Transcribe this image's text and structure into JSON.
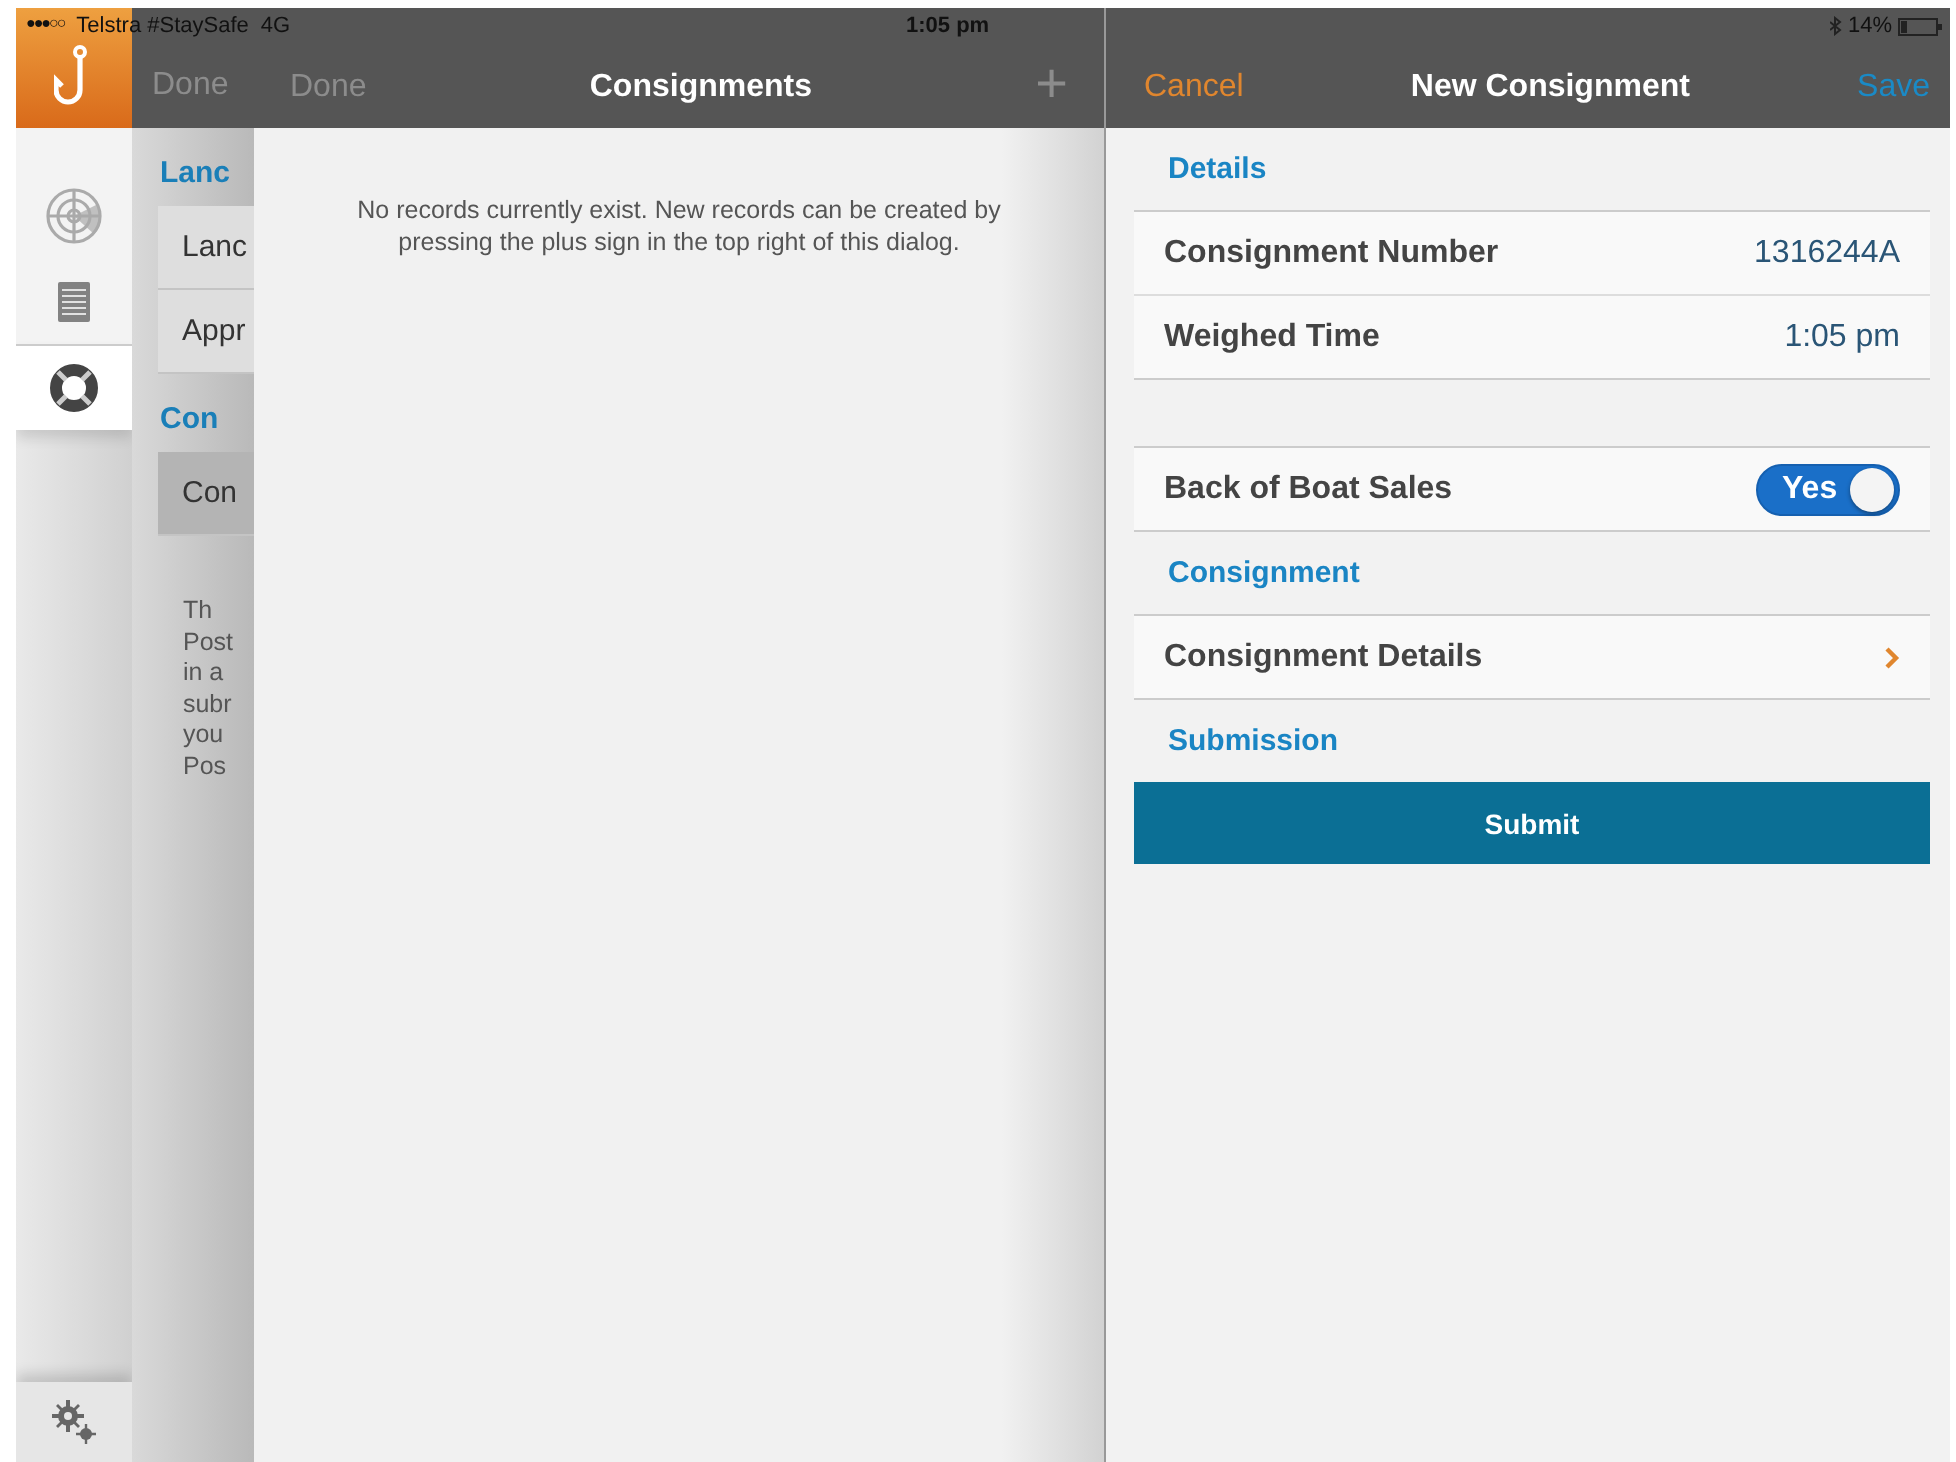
{
  "status_bar": {
    "signal": "●●●○○",
    "carrier": "Telstra #StaySafe",
    "network": "4G",
    "time": "1:05 pm",
    "battery": "14%"
  },
  "sidebar": {
    "items": [
      {
        "selected": false
      },
      {
        "selected": false
      },
      {
        "selected": true
      }
    ]
  },
  "back_panel": {
    "left_button": {
      "label": "Done",
      "disabled": true
    },
    "sections": [
      {
        "header": "Lanc",
        "rows": [
          {
            "label": "Lanc",
            "selected": false
          },
          {
            "label": "Appr",
            "selected": false
          }
        ]
      },
      {
        "header": "Con",
        "rows": [
          {
            "label": "Con",
            "selected": true
          }
        ]
      }
    ],
    "note_lines": [
      "Th",
      "Post",
      "in a",
      "subr",
      "you",
      "Pos"
    ]
  },
  "consignments_panel": {
    "title": "Consignments",
    "left_button": {
      "label": "Done",
      "disabled": true
    },
    "add_button": {
      "label": "+",
      "disabled": true
    },
    "message": "No records currently exist. New records can be created by pressing the plus sign in the top right of this dialog."
  },
  "form": {
    "title": "New Consignment",
    "cancel": "Cancel",
    "save": "Save",
    "sections": [
      {
        "header": "Details",
        "rows": [
          {
            "kind": "value",
            "label": "Consignment Number",
            "value": "1316244A"
          },
          {
            "kind": "value",
            "label": "Weighed Time",
            "value": "1:05 pm"
          }
        ]
      },
      {
        "rows": [
          {
            "kind": "toggle",
            "label": "Back of Boat Sales",
            "value": "Yes",
            "on": true
          }
        ]
      },
      {
        "header": "Consignment",
        "rows": [
          {
            "kind": "link",
            "label": "Consignment Details"
          }
        ]
      },
      {
        "header": "Submission",
        "rows": [
          {
            "kind": "button",
            "label": "Submit"
          }
        ]
      }
    ]
  }
}
